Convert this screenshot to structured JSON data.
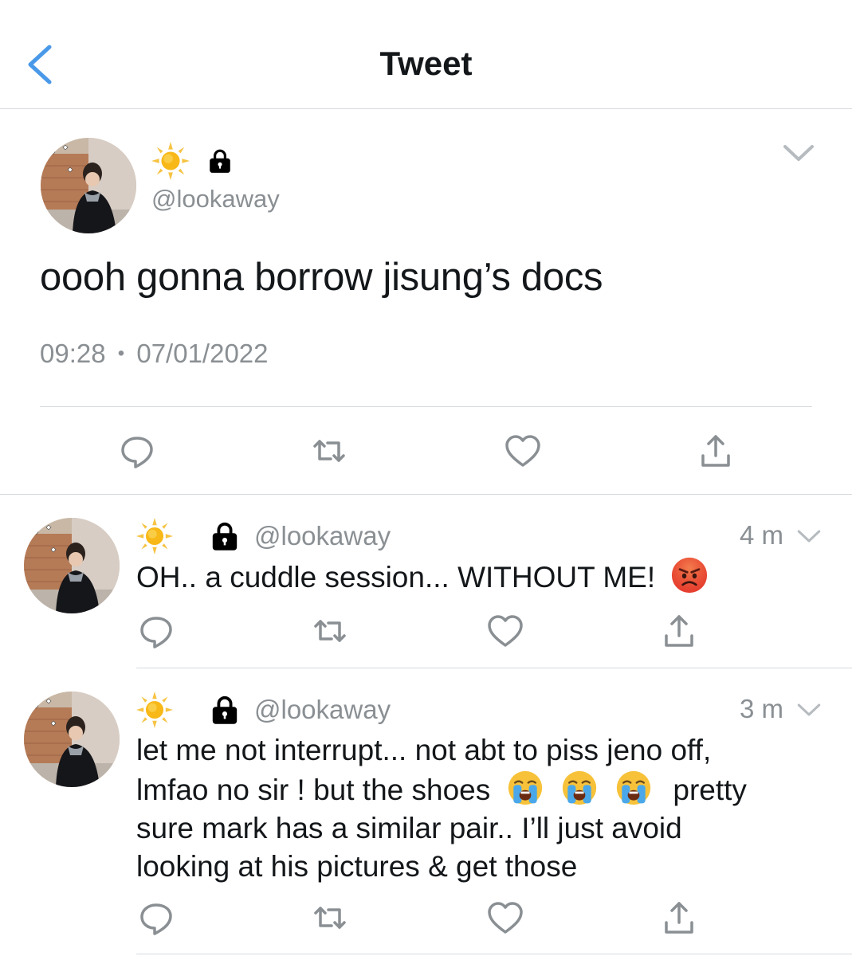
{
  "header": {
    "title": "Tweet"
  },
  "main_tweet": {
    "display_name_emoji": "sun-emoji",
    "protected_icon": "lock-icon",
    "handle": "@lookaway",
    "text": "oooh gonna borrow jisung’s docs",
    "time": "09:28",
    "separator": "•",
    "date": "07/01/2022"
  },
  "replies": [
    {
      "handle": "@lookaway",
      "time": "4 m",
      "text_before": "OH.. a cuddle session... WITHOUT ME!",
      "emoji": "angry-face-emoji"
    },
    {
      "handle": "@lookaway",
      "time": "3 m",
      "line1": "let me not interrupt... not abt to piss jeno off,",
      "line2_a": "lmfao no sir ! but the shoes",
      "line2_b": "pretty",
      "line3": "sure mark has a similar pair.. I’ll just avoid",
      "line4": "looking at his pictures & get those",
      "emoji": "loudly-crying-face-emoji"
    }
  ],
  "colors": {
    "accent": "#4a99e9",
    "text": "#14171a",
    "muted": "#8a8f93",
    "divider": "#d6d9dc"
  }
}
